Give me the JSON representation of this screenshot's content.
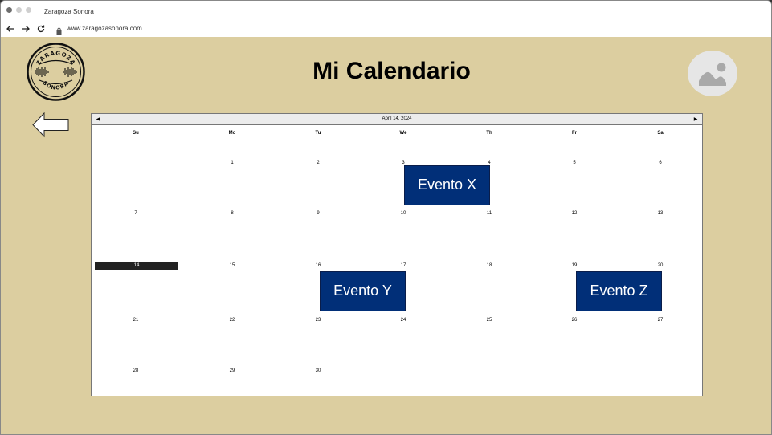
{
  "browser": {
    "tab_title": "Zaragoza Sonora",
    "url": "www.zaragozasonora.com"
  },
  "header": {
    "title": "Mi Calendario",
    "logo": {
      "top_text": "ZARAGOZA",
      "bottom_text": "SONORA"
    }
  },
  "calendar": {
    "current_date": "April 14, 2024",
    "weekdays": [
      "Su",
      "Mo",
      "Tu",
      "We",
      "Th",
      "Fr",
      "Sa"
    ],
    "days": [
      {
        "label": "1",
        "col": 1,
        "row": 0
      },
      {
        "label": "2",
        "col": 2,
        "row": 0
      },
      {
        "label": "3",
        "col": 3,
        "row": 0
      },
      {
        "label": "4",
        "col": 4,
        "row": 0
      },
      {
        "label": "5",
        "col": 5,
        "row": 0
      },
      {
        "label": "6",
        "col": 6,
        "row": 0
      },
      {
        "label": "7",
        "col": 0,
        "row": 1
      },
      {
        "label": "8",
        "col": 1,
        "row": 1
      },
      {
        "label": "9",
        "col": 2,
        "row": 1
      },
      {
        "label": "10",
        "col": 3,
        "row": 1
      },
      {
        "label": "11",
        "col": 4,
        "row": 1
      },
      {
        "label": "12",
        "col": 5,
        "row": 1
      },
      {
        "label": "13",
        "col": 6,
        "row": 1
      },
      {
        "label": "14",
        "col": 0,
        "row": 2,
        "today": true
      },
      {
        "label": "15",
        "col": 1,
        "row": 2
      },
      {
        "label": "16",
        "col": 2,
        "row": 2
      },
      {
        "label": "17",
        "col": 3,
        "row": 2
      },
      {
        "label": "18",
        "col": 4,
        "row": 2
      },
      {
        "label": "19",
        "col": 5,
        "row": 2
      },
      {
        "label": "20",
        "col": 6,
        "row": 2
      },
      {
        "label": "21",
        "col": 0,
        "row": 3
      },
      {
        "label": "22",
        "col": 1,
        "row": 3
      },
      {
        "label": "23",
        "col": 2,
        "row": 3
      },
      {
        "label": "24",
        "col": 3,
        "row": 3
      },
      {
        "label": "25",
        "col": 4,
        "row": 3
      },
      {
        "label": "26",
        "col": 5,
        "row": 3
      },
      {
        "label": "27",
        "col": 6,
        "row": 3
      },
      {
        "label": "28",
        "col": 0,
        "row": 4
      },
      {
        "label": "29",
        "col": 1,
        "row": 4
      },
      {
        "label": "30",
        "col": 2,
        "row": 4
      }
    ],
    "events": [
      {
        "label": "Evento X",
        "col": 3,
        "row": 0
      },
      {
        "label": "Evento Y",
        "col": 2,
        "row": 2
      },
      {
        "label": "Evento Z",
        "col": 5,
        "row": 2
      }
    ]
  },
  "colors": {
    "page_background": "#dccea0",
    "event": "#012f78",
    "today": "#222222"
  }
}
